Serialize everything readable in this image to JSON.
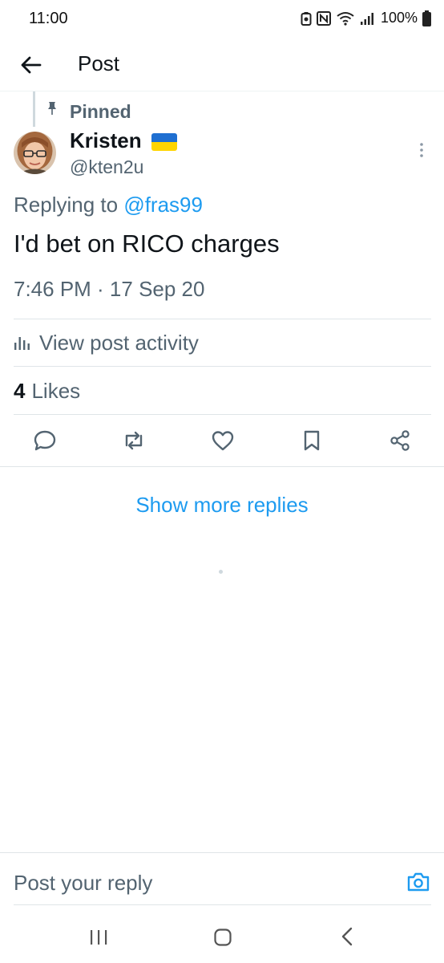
{
  "status_bar": {
    "time": "11:00",
    "battery": "100%",
    "icons": [
      "battery-saver-icon",
      "nfc-icon",
      "wifi-icon",
      "signal-icon",
      "battery-icon"
    ]
  },
  "header": {
    "title": "Post",
    "back_icon": "arrow-left-icon"
  },
  "post": {
    "pinned_label": "Pinned",
    "author_name": "Kristen",
    "author_flag": "ukraine-flag",
    "author_handle": "@kten2u",
    "reply_prefix": "Replying to",
    "reply_to": "@fras99",
    "text": "I'd bet on RICO charges",
    "meta": "7:46 PM · 17 Sep 20",
    "activity_label": "View post activity",
    "likes_count": "4",
    "likes_label": "Likes"
  },
  "actions": [
    "reply-icon",
    "repost-icon",
    "like-icon",
    "bookmark-icon",
    "share-icon"
  ],
  "show_more": "Show more replies",
  "reply_bar": {
    "placeholder": "Post your reply"
  },
  "colors": {
    "accent": "#1d9bf0",
    "text_primary": "#0f1419",
    "text_secondary": "#536471",
    "divider": "#dfe5e8"
  }
}
